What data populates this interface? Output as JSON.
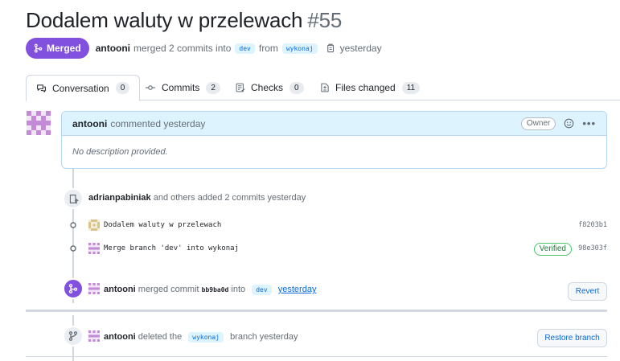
{
  "pr": {
    "title": "Dodalem waluty w przelewach",
    "number": "#55",
    "status": "Merged",
    "author": "antooni",
    "merge_text": "merged 2 commits into",
    "base_branch": "dev",
    "from_text": "from",
    "head_branch": "wykonaj",
    "time": "yesterday"
  },
  "tabs": [
    {
      "label": "Conversation",
      "count": "0",
      "icon": "conversation-icon"
    },
    {
      "label": "Commits",
      "count": "2",
      "icon": "commit-icon"
    },
    {
      "label": "Checks",
      "count": "0",
      "icon": "checklist-icon"
    },
    {
      "label": "Files changed",
      "count": "11",
      "icon": "file-diff-icon"
    }
  ],
  "comment": {
    "author": "antooni",
    "action": "commented yesterday",
    "role": "Owner",
    "body": "No description provided."
  },
  "timeline": {
    "commits_event": {
      "author": "adrianpabiniak",
      "text": "and others added 2 commits yesterday"
    },
    "commits": [
      {
        "message": "Dodalem waluty w przelewach",
        "sha": "f8203b1",
        "verified": ""
      },
      {
        "message": "Merge branch 'dev' into wykonaj",
        "sha": "98e303f",
        "verified": "Verified"
      }
    ],
    "merged_event": {
      "author": "antooni",
      "text": "merged commit",
      "hash": "bb9ba0d",
      "into": "into",
      "branch": "dev",
      "time": "yesterday",
      "button": "Revert"
    },
    "deleted_event": {
      "author": "antooni",
      "text": "deleted the",
      "branch": "wykonaj",
      "suffix": "branch yesterday",
      "button": "Restore branch"
    }
  },
  "colors": {
    "merged": "#8250df",
    "link": "#0969da",
    "verified": "#1a7f37"
  }
}
